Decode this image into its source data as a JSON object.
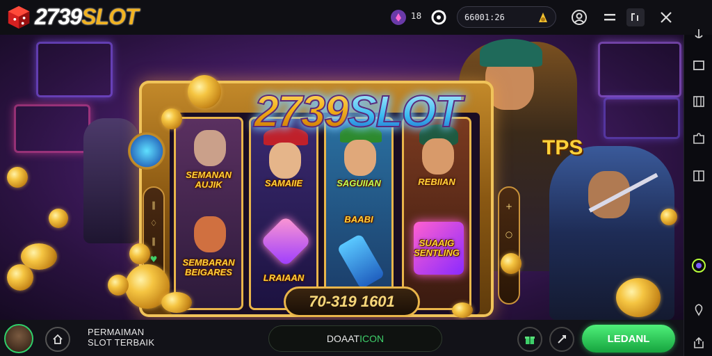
{
  "header": {
    "logo_number": "2739",
    "logo_word": "SLOT",
    "notification_count": "18",
    "balance": "66001:26"
  },
  "marquee": {
    "title_number": "2739",
    "title_word": "SLOT"
  },
  "reels": [
    {
      "top_label": "SEMANAN AUJIK",
      "bottom_label": "SEMBARAN BEIGARES"
    },
    {
      "top_label": "SAMAIIE",
      "bottom_label": "LRAIAAN"
    },
    {
      "top_label": "SAGUIIAN",
      "bottom_label": "BAABI"
    },
    {
      "top_label": "REBIIAN",
      "bottom_label": "SUAAIG SENTLING"
    }
  ],
  "machine": {
    "plate_value": "70-319 1601",
    "side_badge": "TPS"
  },
  "footer": {
    "caption_line1": "PERMAIMAN",
    "caption_line2": "SLOT TERBAIK",
    "input_prefix": "DOAAT",
    "input_suffix": "ICON",
    "cta_label": "LEDANL"
  },
  "colors": {
    "accent_gold": "#f2b321",
    "cta_green": "#2fd06a",
    "stage_purple": "#4a1f6e"
  }
}
